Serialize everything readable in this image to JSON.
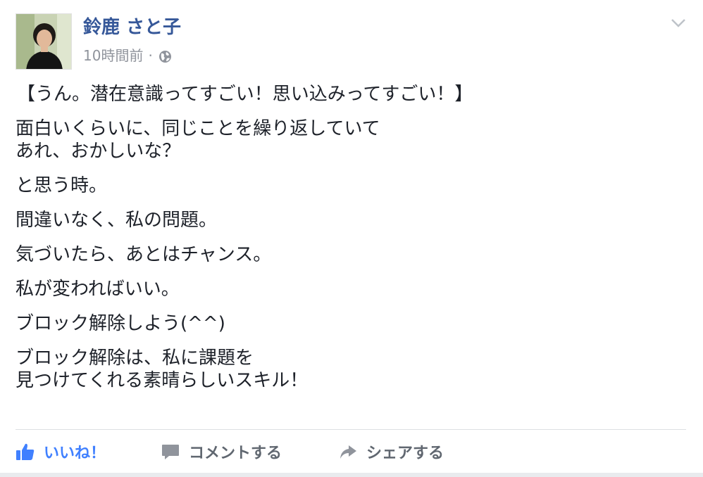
{
  "post": {
    "author_name": "鈴鹿 さと子",
    "time": "10時間前",
    "separator": "·",
    "paragraphs": [
      [
        "【うん。潜在意識ってすごい！思い込みってすごい！】"
      ],
      [
        "面白いくらいに、同じことを繰り返していて",
        "あれ、おかしいな？"
      ],
      [
        "と思う時。"
      ],
      [
        "間違いなく、私の問題。"
      ],
      [
        "気づいたら、あとはチャンス。"
      ],
      [
        "私が変わればいい。"
      ],
      [
        "ブロック解除しよう(^^)"
      ],
      [
        "ブロック解除は、私に課題を",
        "見つけてくれる素晴らしいスキル！"
      ]
    ]
  },
  "actions": {
    "like_label": "いいね！",
    "comment_label": "コメントする",
    "share_label": "シェアする"
  },
  "colors": {
    "author": "#365899",
    "meta": "#90949c",
    "like": "#4080ff",
    "action": "#606770",
    "text": "#1d2129"
  },
  "icons": [
    "globe-icon",
    "chevron-down-icon",
    "thumbs-up-icon",
    "comment-icon",
    "share-icon"
  ]
}
